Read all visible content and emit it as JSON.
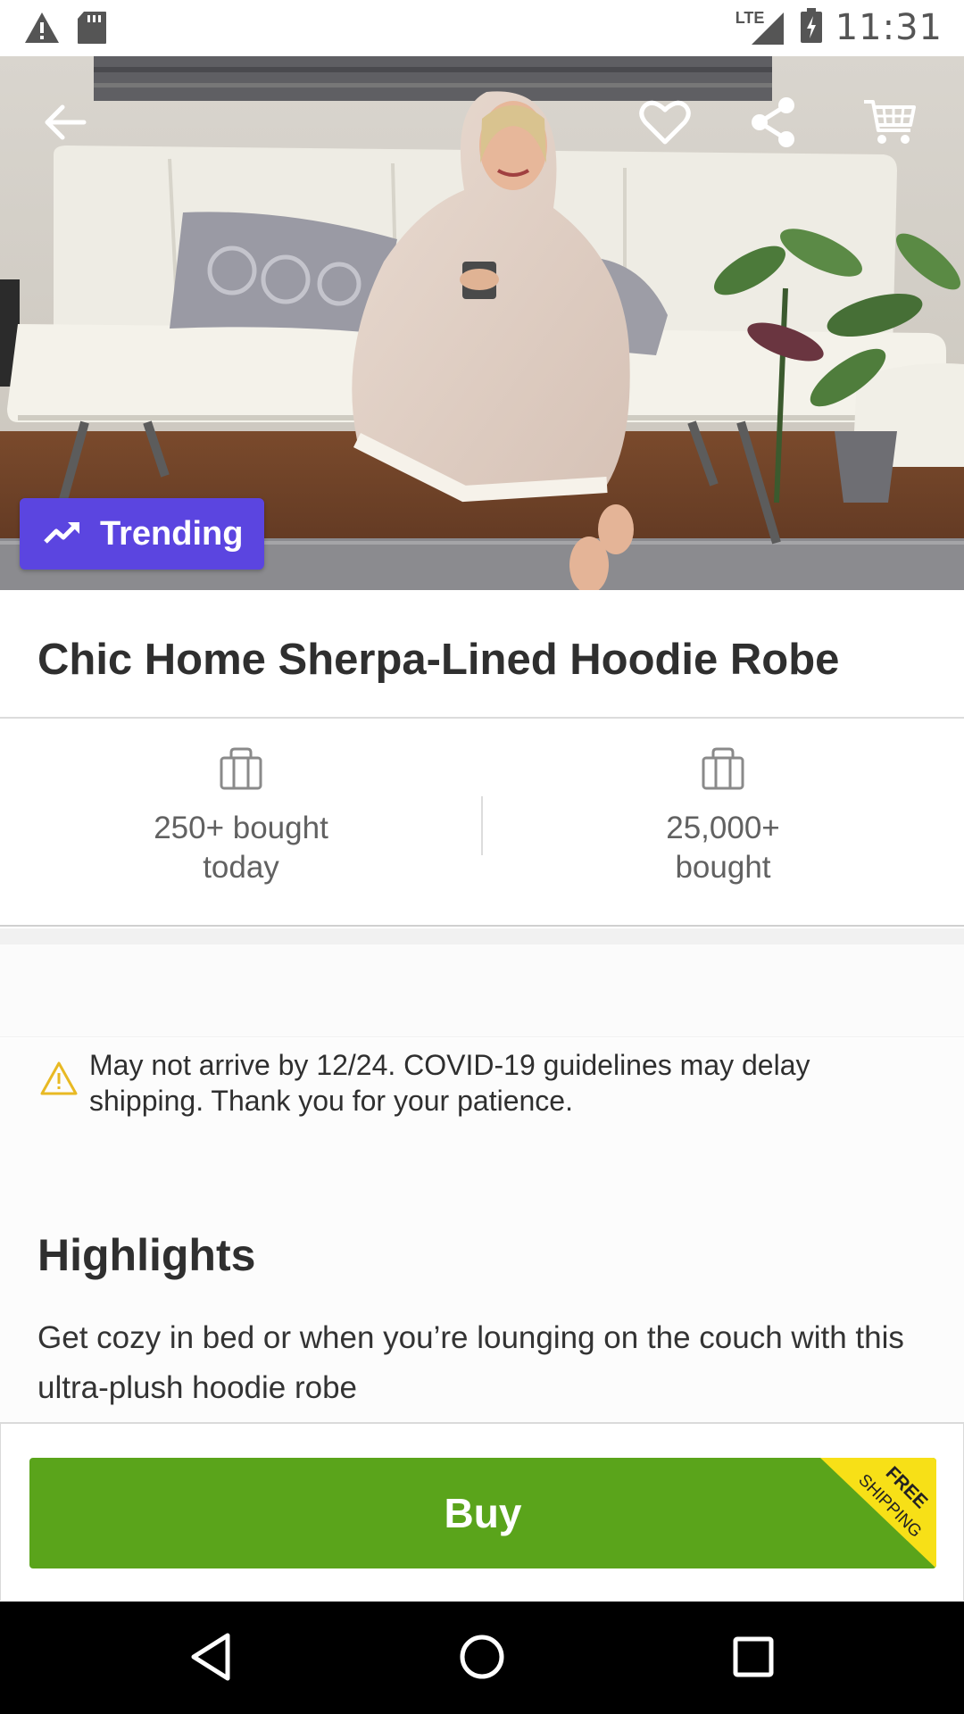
{
  "status_bar": {
    "time": "11:31",
    "network_label": "LTE",
    "icons": [
      "warning-icon",
      "sd-card-icon",
      "signal-icon",
      "battery-charging-icon"
    ]
  },
  "hero": {
    "badge_label": "Trending",
    "icons": [
      "back-arrow-icon",
      "heart-icon",
      "share-icon",
      "cart-icon",
      "trending-icon"
    ]
  },
  "product": {
    "title": "Chic Home Sherpa-Lined Hoodie Robe"
  },
  "stats": [
    {
      "line1": "250+ bought",
      "line2": "today",
      "icon": "shopping-bag-icon"
    },
    {
      "line1": "25,000+",
      "line2": "bought",
      "icon": "shopping-bag-icon"
    }
  ],
  "notice": {
    "line1": "May not arrive by 12/24. COVID-19 guidelines may delay",
    "line2": "shipping. Thank you for your patience.",
    "icon": "warning-triangle-icon"
  },
  "highlights": {
    "title": "Highlights",
    "text": "Get cozy in bed or when you’re lounging on the couch with this ultra-plush hoodie robe"
  },
  "buy": {
    "label": "Buy",
    "ribbon_line1": "FREE",
    "ribbon_line2": "SHIPPING"
  },
  "colors": {
    "accent_purple": "#5b45e0",
    "buy_green": "#5aa41b",
    "ribbon_yellow": "#f7e017",
    "notice_yellow": "#e8b923"
  },
  "nav_bar": {
    "icons": [
      "back-nav-icon",
      "home-nav-icon",
      "recents-nav-icon"
    ]
  }
}
